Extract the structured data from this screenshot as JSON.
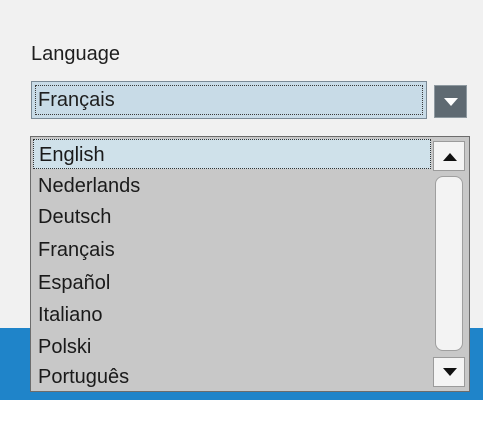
{
  "language_setting": {
    "label": "Language",
    "selected_value": "Français"
  },
  "dropdown": {
    "highlighted_index": 0,
    "options": [
      "English",
      "Nederlands",
      "Deutsch",
      "Français",
      "Español",
      "Italiano",
      "Polski",
      "Português"
    ]
  },
  "icons": {
    "combo_button": "chevron-down-icon",
    "scroll_up": "arrow-up-icon",
    "scroll_down": "arrow-down-icon"
  },
  "colors": {
    "panel_bg": "#f1f1f1",
    "accent_band": "#1f84c9",
    "selection_bg": "#c8dbe7",
    "list_bg": "#c8c8c8"
  }
}
